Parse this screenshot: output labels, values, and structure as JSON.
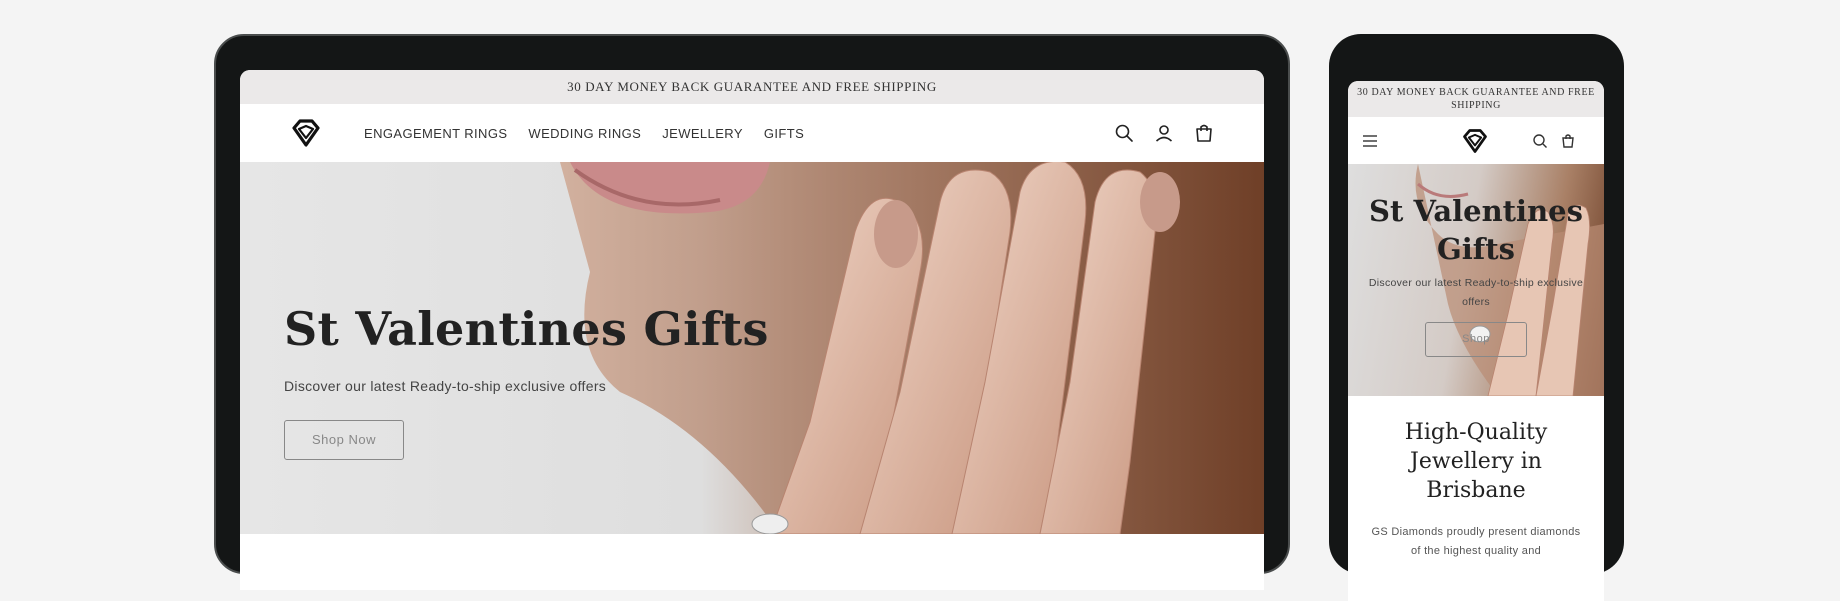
{
  "announcement": "30 DAY MONEY BACK GUARANTEE AND FREE SHIPPING",
  "nav": {
    "items": [
      {
        "label": "ENGAGEMENT RINGS"
      },
      {
        "label": "WEDDING RINGS"
      },
      {
        "label": "JEWELLERY"
      },
      {
        "label": "GIFTS"
      }
    ]
  },
  "icons": {
    "search": "search-icon",
    "account": "account-icon",
    "cart": "cart-icon",
    "menu": "menu-icon",
    "logo": "diamond-logo-icon"
  },
  "hero": {
    "title": "St Valentines Gifts",
    "subtitle": "Discover our latest Ready-to-ship exclusive offers",
    "button": "Shop Now",
    "mobile_button": "Shop"
  },
  "section": {
    "heading": "High-Quality Jewellery in Brisbane",
    "body": "GS Diamonds proudly present diamonds of the highest quality and"
  },
  "colors": {
    "device_frame": "#141616",
    "announcement_bg": "#ebe9e9",
    "text": "#222222",
    "page_bg": "#f4f4f4"
  }
}
